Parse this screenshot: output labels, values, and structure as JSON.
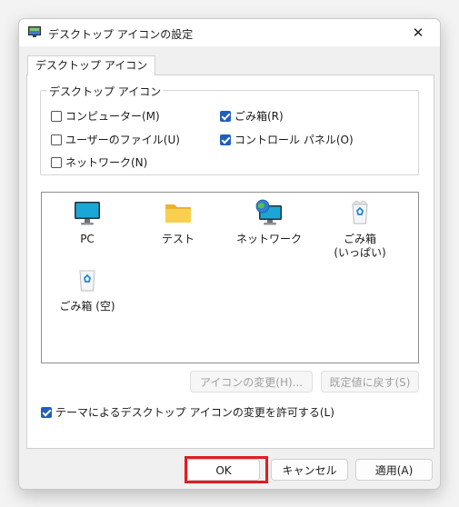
{
  "window": {
    "title": "デスクトップ アイコンの設定",
    "close_glyph": "✕"
  },
  "tab": {
    "label": "デスクトップ アイコン"
  },
  "group": {
    "legend": "デスクトップ アイコン",
    "options": [
      {
        "label": "コンピューター(M)",
        "checked": false
      },
      {
        "label": "ごみ箱(R)",
        "checked": true
      },
      {
        "label": "ユーザーのファイル(U)",
        "checked": false
      },
      {
        "label": "コントロール パネル(O)",
        "checked": true
      },
      {
        "label": "ネットワーク(N)",
        "checked": false
      }
    ]
  },
  "icons": [
    {
      "label": "PC",
      "icon": "monitor-icon"
    },
    {
      "label": "テスト",
      "icon": "folder-icon"
    },
    {
      "label": "ネットワーク",
      "icon": "network-globe-icon"
    },
    {
      "label": "ごみ箱\n(いっぱい)",
      "icon": "recycle-bin-full-icon"
    },
    {
      "label": "ごみ箱 (空)",
      "icon": "recycle-bin-empty-icon"
    }
  ],
  "buttons": {
    "change_icon": "アイコンの変更(H)...",
    "restore_default": "既定値に戻す(S)",
    "ok": "OK",
    "cancel": "キャンセル",
    "apply": "適用(A)"
  },
  "theme_option": {
    "label": "テーマによるデスクトップ アイコンの変更を許可する(L)",
    "checked": true
  },
  "colors": {
    "accent": "#1f5fbf",
    "highlight": "#e11b22"
  }
}
